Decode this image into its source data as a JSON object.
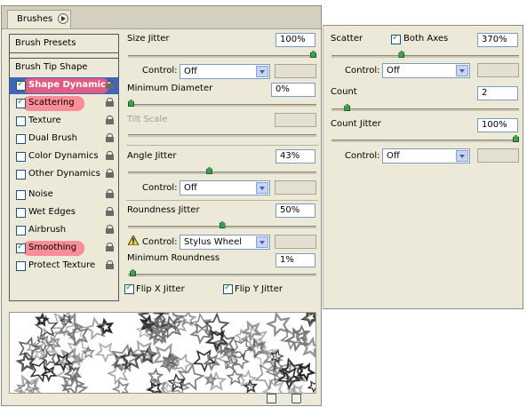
{
  "tab": {
    "title": "Brushes"
  },
  "options": {
    "presets": "Brush Presets",
    "tip_shape": "Brush Tip Shape",
    "items": [
      {
        "label": "Shape Dynamics",
        "checked": true
      },
      {
        "label": "Scattering",
        "checked": true
      },
      {
        "label": "Texture",
        "checked": false
      },
      {
        "label": "Dual Brush",
        "checked": false
      },
      {
        "label": "Color Dynamics",
        "checked": false
      },
      {
        "label": "Other Dynamics",
        "checked": false
      },
      {
        "label": "Noise",
        "checked": false
      },
      {
        "label": "Wet Edges",
        "checked": false
      },
      {
        "label": "Airbrush",
        "checked": false
      },
      {
        "label": "Smoothing",
        "checked": true
      },
      {
        "label": "Protect Texture",
        "checked": false
      }
    ]
  },
  "shape_dynamics": {
    "size_jitter": {
      "label": "Size Jitter",
      "value": "100%",
      "level": 1.0
    },
    "size_control": {
      "label": "Control:",
      "value": "Off"
    },
    "min_diameter": {
      "label": "Minimum Diameter",
      "value": "0%",
      "level": 0.0
    },
    "tilt_scale": {
      "label": "Tilt Scale"
    },
    "angle_jitter": {
      "label": "Angle Jitter",
      "value": "43%",
      "level": 0.43
    },
    "angle_control": {
      "label": "Control:",
      "value": "Off"
    },
    "roundness_jitter": {
      "label": "Roundness Jitter",
      "value": "50%",
      "level": 0.5
    },
    "roundness_control": {
      "label": "Control:",
      "value": "Stylus Wheel"
    },
    "min_roundness": {
      "label": "Minimum Roundness",
      "value": "1%",
      "level": 0.01
    },
    "flip_x": {
      "label": "Flip X Jitter",
      "checked": true
    },
    "flip_y": {
      "label": "Flip Y Jitter",
      "checked": true
    }
  },
  "scattering": {
    "scatter": {
      "label": "Scatter",
      "value": "370%",
      "level": 0.37
    },
    "both_axes": {
      "label": "Both Axes",
      "checked": true
    },
    "scatter_control": {
      "label": "Control:",
      "value": "Off"
    },
    "count": {
      "label": "Count",
      "value": "2",
      "level": 0.07
    },
    "count_jitter": {
      "label": "Count Jitter",
      "value": "100%",
      "level": 1.0
    },
    "count_control": {
      "label": "Control:",
      "value": "Off"
    }
  },
  "colors": {
    "highlight": "#ff5a78",
    "selected": "#3f66b8",
    "slider_thumb": "#3f9e4f",
    "panel": "#ece9d8"
  }
}
